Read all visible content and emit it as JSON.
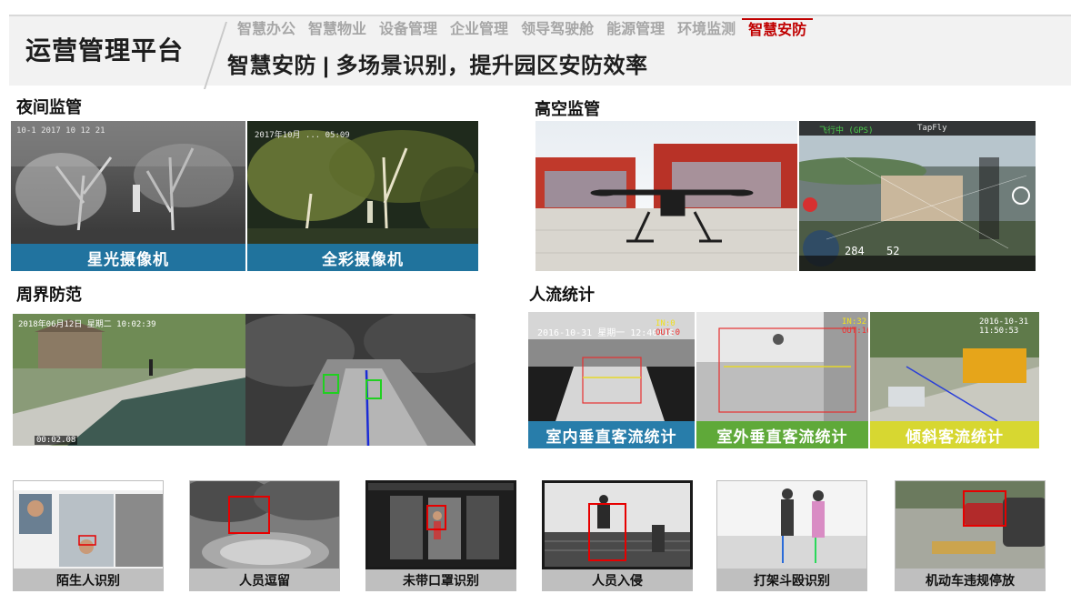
{
  "header": {
    "platform_title": "运营管理平台",
    "page_subtitle": "智慧安防 | 多场景识别，提升园区安防效率",
    "tabs": [
      {
        "label": "智慧办公",
        "active": false
      },
      {
        "label": "智慧物业",
        "active": false
      },
      {
        "label": "设备管理",
        "active": false
      },
      {
        "label": "企业管理",
        "active": false
      },
      {
        "label": "领导驾驶舱",
        "active": false
      },
      {
        "label": "能源管理",
        "active": false
      },
      {
        "label": "环境监测",
        "active": false
      },
      {
        "label": "智慧安防",
        "active": true
      }
    ]
  },
  "colors": {
    "accent_red": "#c00000",
    "caption_blue": "#1f78a8",
    "caption_green": "#5aa832",
    "caption_yellow": "#d8d829",
    "detect_red": "#e60000"
  },
  "sections": {
    "night": {
      "title": "夜间监管",
      "cams": [
        {
          "caption": "星光摄像机",
          "stamp": "10-1 2017 10 12 21",
          "watermark": "星光摄像机"
        },
        {
          "caption": "全彩摄像机",
          "stamp": "2017年10月 ... 05:09",
          "watermark": "全彩摄像机"
        }
      ]
    },
    "aerial": {
      "title": "高空监管",
      "hud": {
        "mode": "飞行中 (GPS)",
        "app": "TapFly",
        "distance": "284",
        "height": "52"
      }
    },
    "perimeter": {
      "title": "周界防范",
      "stamp": "2018年06月12日 星期二 10:02:39",
      "timecode": "00:02.08"
    },
    "flow": {
      "title": "人流统计",
      "cams": [
        {
          "caption": "室内垂直客流统计",
          "stamp": "2016-10-31 星期一 12:40:18",
          "in": "IN:0",
          "out": "OUT:0"
        },
        {
          "caption": "室外垂直客流统计",
          "in": "IN:32",
          "out": "OUT:16"
        },
        {
          "caption": "倾斜客流统计",
          "stamp": "2016-10-31 11:50:53"
        }
      ]
    }
  },
  "scenarios": [
    {
      "label": "陌生人识别",
      "icon": "face-id-icon"
    },
    {
      "label": "人员逗留",
      "icon": "loiter-icon"
    },
    {
      "label": "未带口罩识别",
      "icon": "mask-icon"
    },
    {
      "label": "人员入侵",
      "icon": "intrusion-icon"
    },
    {
      "label": "打架斗殴识别",
      "icon": "fight-icon"
    },
    {
      "label": "机动车违规停放",
      "icon": "parking-icon"
    }
  ]
}
